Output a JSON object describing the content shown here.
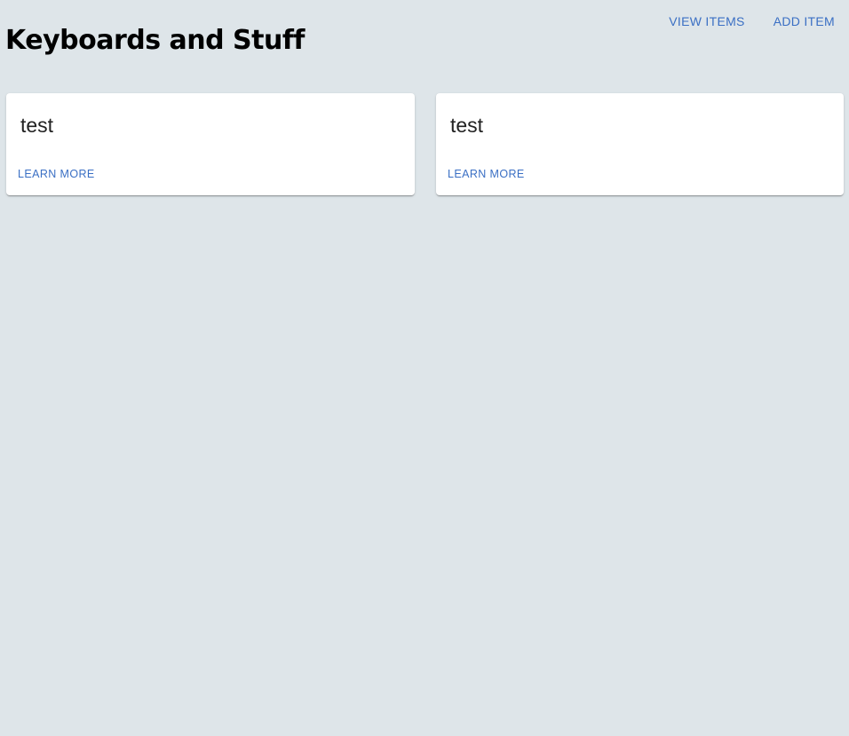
{
  "header": {
    "title": "Keyboards and Stuff",
    "nav": [
      {
        "label": "VIEW ITEMS"
      },
      {
        "label": "ADD ITEM"
      }
    ]
  },
  "cards": [
    {
      "title": "test",
      "action_label": "LEARN MORE"
    },
    {
      "title": "test",
      "action_label": "LEARN MORE"
    }
  ],
  "colors": {
    "background": "#dee5e9",
    "card": "#ffffff",
    "link": "#3a6fc4",
    "title_text": "#000000",
    "card_text": "#222222"
  }
}
